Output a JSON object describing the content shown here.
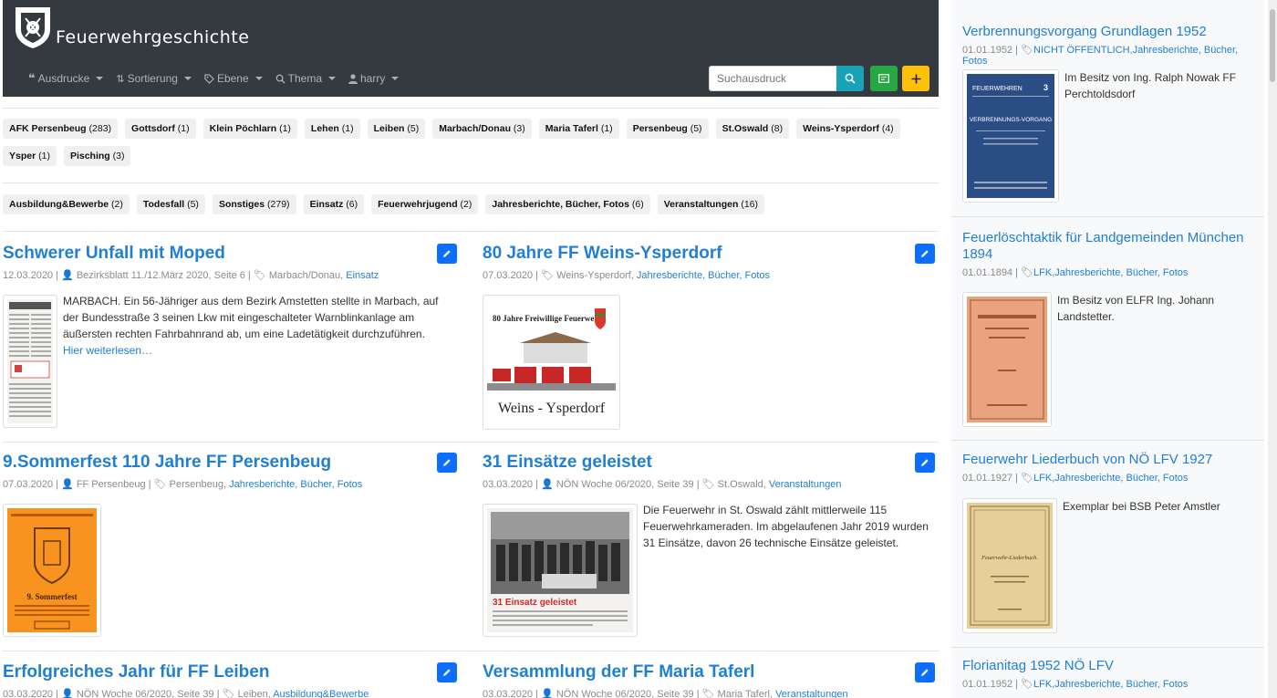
{
  "header": {
    "brand_title": "Feuerwehrgeschichte",
    "menu": [
      {
        "label": "Ausdrucke",
        "icon": "quote-icon"
      },
      {
        "label": "Sortierung",
        "icon": "sort-icon"
      },
      {
        "label": "Ebene",
        "icon": "tag-icon"
      },
      {
        "label": "Thema",
        "icon": "search-icon"
      },
      {
        "label": "harry",
        "icon": "user-icon"
      }
    ],
    "search_placeholder": "Suchausdruck"
  },
  "location_tags": [
    {
      "label": "AFK Persenbeug",
      "count": "(283)"
    },
    {
      "label": "Gottsdorf",
      "count": "(1)"
    },
    {
      "label": "Klein Pöchlarn",
      "count": "(1)"
    },
    {
      "label": "Lehen",
      "count": "(1)"
    },
    {
      "label": "Leiben",
      "count": "(5)"
    },
    {
      "label": "Marbach/Donau",
      "count": "(3)"
    },
    {
      "label": "Maria Taferl",
      "count": "(1)"
    },
    {
      "label": "Persenbeug",
      "count": "(5)"
    },
    {
      "label": "St.Oswald",
      "count": "(8)"
    },
    {
      "label": "Weins-Ysperdorf",
      "count": "(4)"
    },
    {
      "label": "Ysper",
      "count": "(1)"
    },
    {
      "label": "Pisching",
      "count": "(3)"
    }
  ],
  "topic_tags": [
    {
      "label": "Ausbildung&Bewerbe",
      "count": "(2)"
    },
    {
      "label": "Todesfall",
      "count": "(5)"
    },
    {
      "label": "Sonstiges",
      "count": "(279)"
    },
    {
      "label": "Einsatz",
      "count": "(6)"
    },
    {
      "label": "Feuerwehrjugend",
      "count": "(2)"
    },
    {
      "label": "Jahresberichte, Bücher, Fotos",
      "count": "(6)"
    },
    {
      "label": "Veranstaltungen",
      "count": "(16)"
    }
  ],
  "posts": [
    {
      "title": "Schwerer Unfall mit Moped",
      "date": "12.03.2020",
      "source": "Bezirksblatt 11./12.März 2020, Seite 6",
      "place": "Marbach/Donau,",
      "category": "Einsatz",
      "excerpt": "MARBACH. Ein 56-Jähriger aus dem Bezirk Amstetten stellte in Marbach, auf der Bundesstraße 3 seinen Lkw mit eingeschalteter Warnblinkanlage am äußersten rechten Fahrbahnrand ab, um eine Ladetätigkeit durchzuführen.",
      "more": "Hier weiterlesen…"
    },
    {
      "title": "80 Jahre FF Weins-Ysperdorf",
      "date": "07.03.2020",
      "place": "Weins-Ysperdorf,",
      "category": "Jahresberichte, Bücher, Fotos",
      "thumb_heading": "80 Jahre Freiwillige Feuerwehr",
      "thumb_caption": "Weins - Ysperdorf"
    },
    {
      "title": "9.Sommerfest 110 Jahre FF Persenbeug",
      "date": "07.03.2020",
      "source": "FF Persenbeug",
      "place": "Persenbeug,",
      "category": "Jahresberichte, Bücher, Fotos",
      "thumb_caption": "9. Sommerfest"
    },
    {
      "title": "31 Einsätze geleistet",
      "date": "03.03.2020",
      "source": "NÖN Woche 06/2020, Seite 39",
      "place": "St.Oswald,",
      "category": "Veranstaltungen",
      "excerpt": "Die Feuerwehr in St. Oswald zählt mittlerweile 115 Feuerwehrkameraden. Im abgelaufenen Jahr 2019 wurden 31 Einsätze, davon 26 technische Einsätze geleistet.",
      "thumb_caption": "31 Einsatz geleistet"
    },
    {
      "title": "Erfolgreiches Jahr für FF Leiben",
      "date": "03.03.2020",
      "source": "NÖN Woche 06/2020, Seite 39",
      "place": "Leiben,",
      "category": "Ausbildung&Bewerbe"
    },
    {
      "title": "Versammlung der FF Maria Taferl",
      "date": "03.03.2020",
      "source": "NÖN Woche 06/2020, Seite 39",
      "place": "Maria Taferl,",
      "category": "Veranstaltungen"
    }
  ],
  "sidebar": [
    {
      "title": "Verbrennungsvorgang Grundlagen 1952",
      "date": "01.01.1952",
      "tags": "NICHT ÖFFENTLICH,Jahresberichte, Bücher, Fotos",
      "text": "Im Besitz von Ing. Ralph Nowak FF Perchtoldsdorf",
      "thumb_header": "FEUERWEHREN",
      "thumb_number": "3",
      "thumb_title": "VERBRENNUNGS-VORGANG"
    },
    {
      "title": "Feuerlöschtaktik für Landgemeinden München 1894",
      "date": "01.01.1894",
      "tags": "LFK,Jahresberichte, Bücher, Fotos",
      "text": "Im Besitz von ELFR Ing. Johann Landstetter."
    },
    {
      "title": "Feuerwehr Liederbuch von NÖ LFV 1927",
      "date": "01.01.1927",
      "tags": "LFK,Jahresberichte, Bücher, Fotos",
      "text": "Exemplar bei BSB Peter Amstler",
      "thumb_title": "Feuerwehr-Liederbuch."
    },
    {
      "title": "Florianitag 1952 NÖ LFV",
      "date": "01.01.1952",
      "tags": "LFK,Jahresberichte, Bücher, Fotos"
    }
  ],
  "colors": {
    "navbar": "#343a40",
    "link": "#1f7fd4",
    "edit_button": "#0d6efd",
    "search_button": "#17a2b8",
    "green_button": "#28a745",
    "yellow_button": "#ffc107"
  }
}
